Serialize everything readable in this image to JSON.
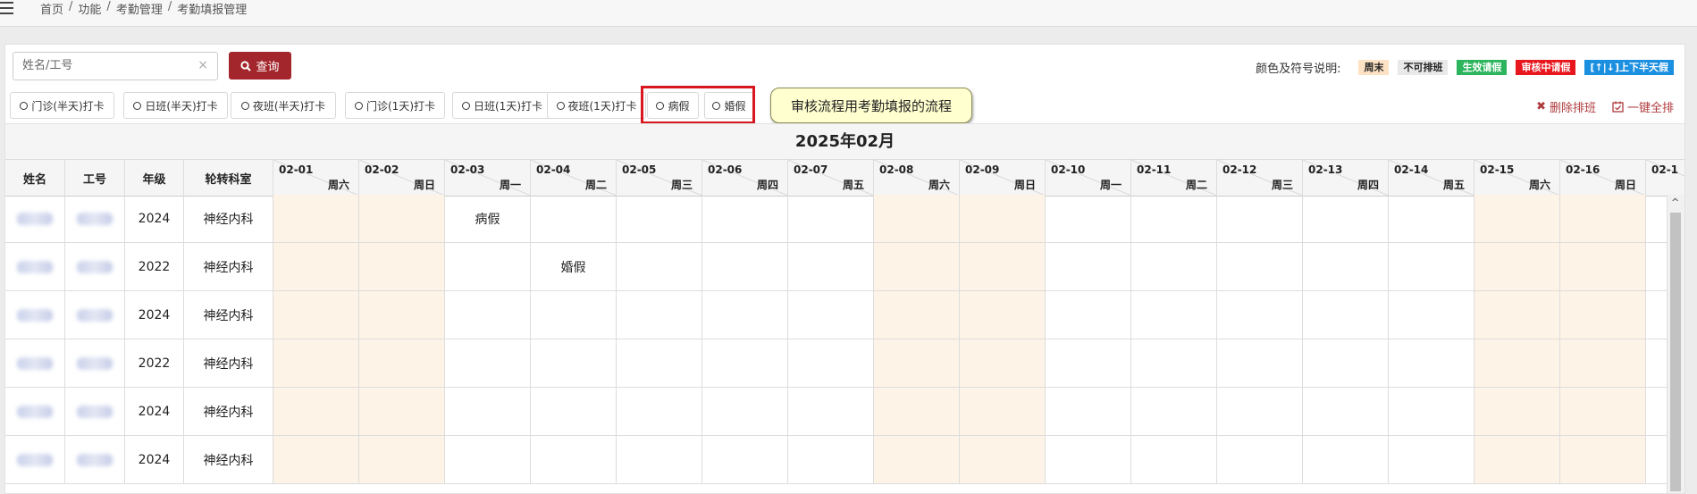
{
  "breadcrumb": [
    "首页",
    "功能",
    "考勤管理",
    "考勤填报管理"
  ],
  "search": {
    "placeholder": "姓名/工号",
    "clear": "×",
    "button_label": "查询"
  },
  "legend": {
    "label": "颜色及符号说明:",
    "items": [
      {
        "text": "周末",
        "bg": "#fde2c4",
        "color": "#222"
      },
      {
        "text": "不可排班",
        "bg": "#e9e9e9",
        "color": "#222"
      },
      {
        "text": "生效请假",
        "bg": "#2cb55d",
        "color": "#ffffff"
      },
      {
        "text": "审核中请假",
        "bg": "#e8161d",
        "color": "#ffffff"
      },
      {
        "text": "[↑|↓]上下半天假",
        "bg": "#1b8fe0",
        "color": "#ffffff"
      }
    ]
  },
  "shift_buttons": [
    "门诊(半天)打卡",
    "日班(半天)打卡",
    "夜班(半天)打卡",
    "门诊(1天)打卡",
    "日班(1天)打卡",
    "夜班(1天)打卡",
    "病假",
    "婚假"
  ],
  "tooltip": "审核流程用考勤填报的流程",
  "actions": {
    "delete": "删除排班",
    "fill": "一键全排"
  },
  "month_title": "2025年02月",
  "columns": {
    "name": "姓名",
    "id": "工号",
    "grade": "年级",
    "dept": "轮转科室"
  },
  "days": [
    {
      "date": "02-01",
      "week": "周六",
      "weekend": true
    },
    {
      "date": "02-02",
      "week": "周日",
      "weekend": true
    },
    {
      "date": "02-03",
      "week": "周一",
      "weekend": false
    },
    {
      "date": "02-04",
      "week": "周二",
      "weekend": false
    },
    {
      "date": "02-05",
      "week": "周三",
      "weekend": false
    },
    {
      "date": "02-06",
      "week": "周四",
      "weekend": false
    },
    {
      "date": "02-07",
      "week": "周五",
      "weekend": false
    },
    {
      "date": "02-08",
      "week": "周六",
      "weekend": true
    },
    {
      "date": "02-09",
      "week": "周日",
      "weekend": true
    },
    {
      "date": "02-10",
      "week": "周一",
      "weekend": false
    },
    {
      "date": "02-11",
      "week": "周二",
      "weekend": false
    },
    {
      "date": "02-12",
      "week": "周三",
      "weekend": false
    },
    {
      "date": "02-13",
      "week": "周四",
      "weekend": false
    },
    {
      "date": "02-14",
      "week": "周五",
      "weekend": false
    },
    {
      "date": "02-15",
      "week": "周六",
      "weekend": true
    },
    {
      "date": "02-16",
      "week": "周日",
      "weekend": true
    },
    {
      "date": "02-1",
      "week": "",
      "weekend": false
    }
  ],
  "rows": [
    {
      "grade": "2024",
      "dept": "神经内科",
      "marks": {
        "2": "病假"
      }
    },
    {
      "grade": "2022",
      "dept": "神经内科",
      "marks": {
        "3": "婚假"
      }
    },
    {
      "grade": "2024",
      "dept": "神经内科",
      "marks": {}
    },
    {
      "grade": "2022",
      "dept": "神经内科",
      "marks": {}
    },
    {
      "grade": "2024",
      "dept": "神经内科",
      "marks": {}
    },
    {
      "grade": "2024",
      "dept": "神经内科",
      "marks": {}
    }
  ]
}
